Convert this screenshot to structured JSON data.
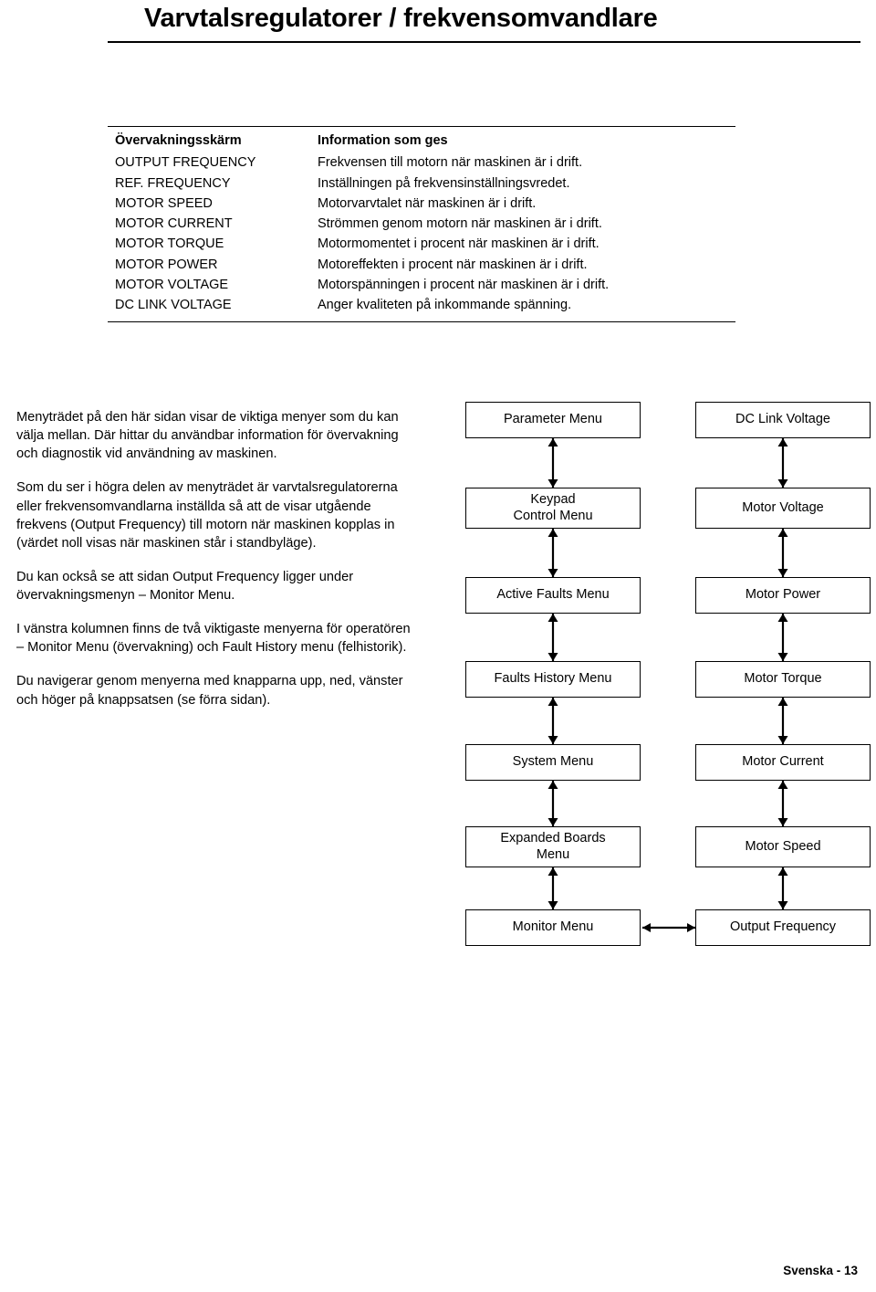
{
  "header": {
    "title": "Varvtalsregulatorer / frekvensomvandlare"
  },
  "table": {
    "columns": [
      "Övervakningsskärm",
      "Information som ges"
    ],
    "rows": [
      {
        "screen": "OUTPUT FREQUENCY",
        "info": "Frekvensen till motorn när maskinen är i drift."
      },
      {
        "screen": "REF. FREQUENCY",
        "info": "Inställningen på frekvensinställningsvredet."
      },
      {
        "screen": "MOTOR SPEED",
        "info": "Motorvarvtalet när maskinen är i drift."
      },
      {
        "screen": "MOTOR CURRENT",
        "info": "Strömmen genom motorn när maskinen är i drift."
      },
      {
        "screen": "MOTOR TORQUE",
        "info": "Motormomentet i procent när maskinen är i drift."
      },
      {
        "screen": "MOTOR POWER",
        "info": "Motoreffekten i procent när maskinen är i drift."
      },
      {
        "screen": "MOTOR VOLTAGE",
        "info": "Motorspänningen i procent när maskinen är i drift."
      },
      {
        "screen": "DC LINK VOLTAGE",
        "info": "Anger kvaliteten på inkommande spänning."
      }
    ]
  },
  "body_text": {
    "p1": "Menyträdet på den här sidan visar de viktiga menyer som du kan välja mellan. Där hittar du användbar information för övervakning och diagnostik vid användning av maskinen.",
    "p2": "Som du ser i högra delen av menyträdet är varvtalsregulatorerna eller frekvensomvandlarna inställda så att de visar utgående frekvens (Output Frequency) till motorn när maskinen kopplas in (värdet noll visas när maskinen står i standbyläge).",
    "p3": "Du kan också se att sidan Output Frequency ligger under övervakningsmenyn – Monitor Menu.",
    "p4": "I vänstra kolumnen finns de två viktigaste menyerna för operatören – Monitor Menu (övervakning) och Fault History menu (felhistorik).",
    "p5": "Du navigerar genom menyerna med knapparna upp, ned, vänster och höger på knappsatsen (se förra sidan)."
  },
  "menu_tree": {
    "left_column": [
      "Parameter Menu",
      "Keypad\nControl Menu",
      "Active Faults Menu",
      "Faults History Menu",
      "System Menu",
      "Expanded Boards\nMenu",
      "Monitor Menu"
    ],
    "right_column": [
      "DC Link Voltage",
      "Motor Voltage",
      "Motor Power",
      "Motor Torque",
      "Motor Current",
      "Motor Speed",
      "Output Frequency"
    ]
  },
  "footer": {
    "text": "Svenska - 13"
  }
}
